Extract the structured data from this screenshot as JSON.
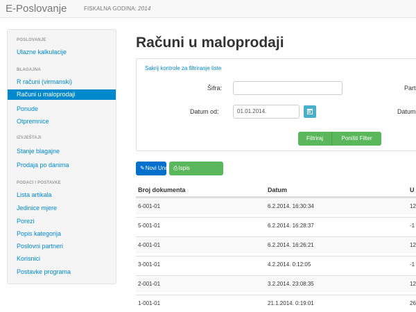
{
  "navbar": {
    "brand": "E-Poslovanje",
    "fiscal_label": "FISKALNA GODINA:",
    "fiscal_year": "2014"
  },
  "sidebar": {
    "section_poslovanje": "POSLOVANJE",
    "item_ulazne": "Ulazne kalkulacije",
    "section_blagajna": "BLAGAJNA",
    "item_r_racuni": "R računi (virmanski)",
    "item_racuni_mp": "Računi u maloprodaji",
    "item_ponude": "Ponude",
    "item_otpremnice": "Otpremnice",
    "section_izvjestaji": "IZVJEŠTAJI",
    "item_stanje": "Stanje blagajne",
    "item_prodaja": "Prodaja po danima",
    "section_podaci": "PODACI I POSTAVKE",
    "item_lista": "Lista artikala",
    "item_jedinice": "Jedinice mjere",
    "item_porezi": "Porezi",
    "item_popis": "Popis kategorija",
    "item_partneri": "Poslovni partneri",
    "item_korisnici": "Korisnici",
    "item_postavke": "Postavke programa"
  },
  "main": {
    "title": "Računi u maloprodaji"
  },
  "filter": {
    "toggle_link": "Sakrij kontrole za filtriranje liste",
    "sifra_label": "Šifra:",
    "sifra_value": "",
    "partner_label_partial": "Part",
    "datum_od_label": "Datum od:",
    "datum_od_value": "01.01.2014.",
    "datum_do_label_partial": "Datum",
    "filter_button": "Filtriraj",
    "reset_button": "Poništi Filter"
  },
  "toolbar": {
    "new_button": "Novi Unos",
    "print_button": "Ispis"
  },
  "table": {
    "col_broj": "Broj dokumenta",
    "col_datum": "Datum",
    "col_third_partial": "U",
    "rows": [
      {
        "broj": "6-001-01",
        "datum": "6.2.2014. 16:30:34",
        "third": "12"
      },
      {
        "broj": "5-001-01",
        "datum": "6.2.2014. 16:28:37",
        "third": "-1"
      },
      {
        "broj": "4-001-01",
        "datum": "6.2.2014. 16:26:21",
        "third": "12"
      },
      {
        "broj": "3-001-01",
        "datum": "4.2.2014. 0:12:05",
        "third": "-1"
      },
      {
        "broj": "2-001-01",
        "datum": "3.2.2014. 23:08:35",
        "third": "12"
      },
      {
        "broj": "1-001-01",
        "datum": "21.1.2014. 0:19:01",
        "third": "26"
      }
    ]
  },
  "colors": {
    "link_blue": "#0088cc",
    "active_bg": "#0088cc",
    "success_green": "#5bb75b",
    "primary_blue": "#0070cc",
    "info_blue": "#49afcd"
  },
  "icons": {
    "calendar": "calendar-icon",
    "pencil": "pencil-icon",
    "print": "print-icon"
  }
}
